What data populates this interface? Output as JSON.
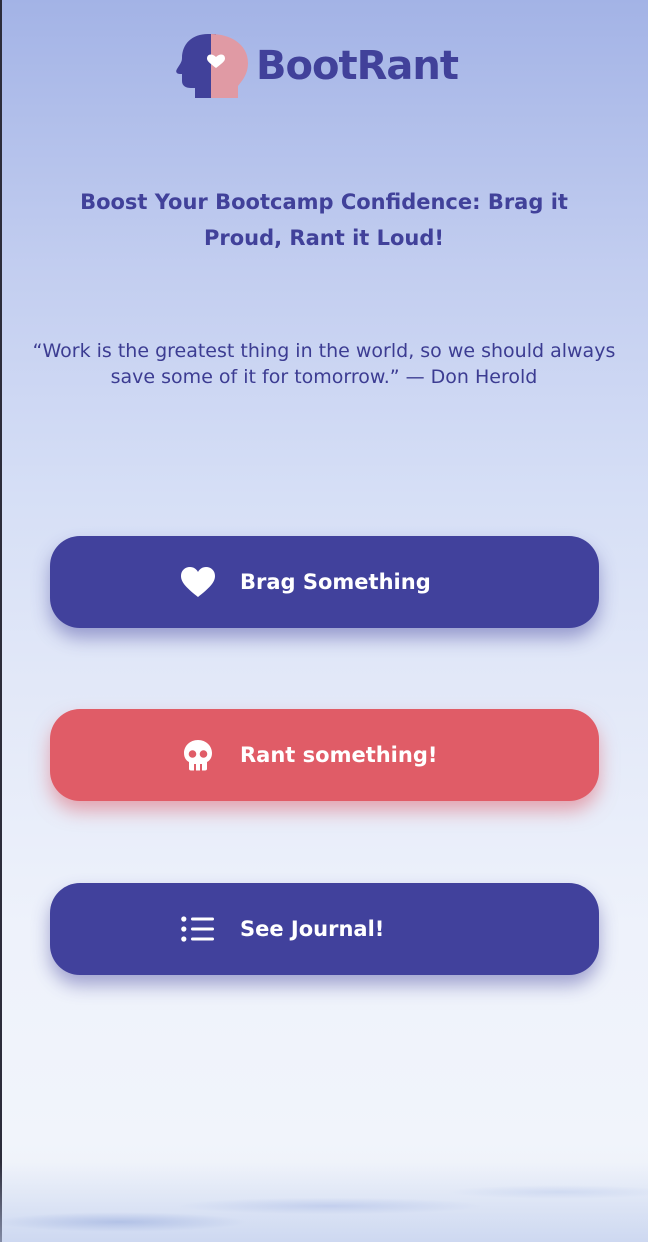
{
  "app": {
    "logo_text": "BootRant",
    "colors": {
      "primary": "#41419c",
      "rant": "#e05c67",
      "logo_head_dark": "#41419a",
      "logo_head_pink": "#e09aa4",
      "text": "#41419a"
    }
  },
  "hero": {
    "tagline": "Boost Your Bootcamp Confidence: Brag it Proud, Rant it Loud!",
    "quote": "“Work is the greatest thing in the world, so we should always save some of it for tomorrow.” — Don Herold"
  },
  "actions": {
    "brag": {
      "label": "Brag Something",
      "icon": "heart-icon"
    },
    "rant": {
      "label": "Rant something!",
      "icon": "skull-icon"
    },
    "journal": {
      "label": "See Journal!",
      "icon": "list-icon"
    }
  }
}
